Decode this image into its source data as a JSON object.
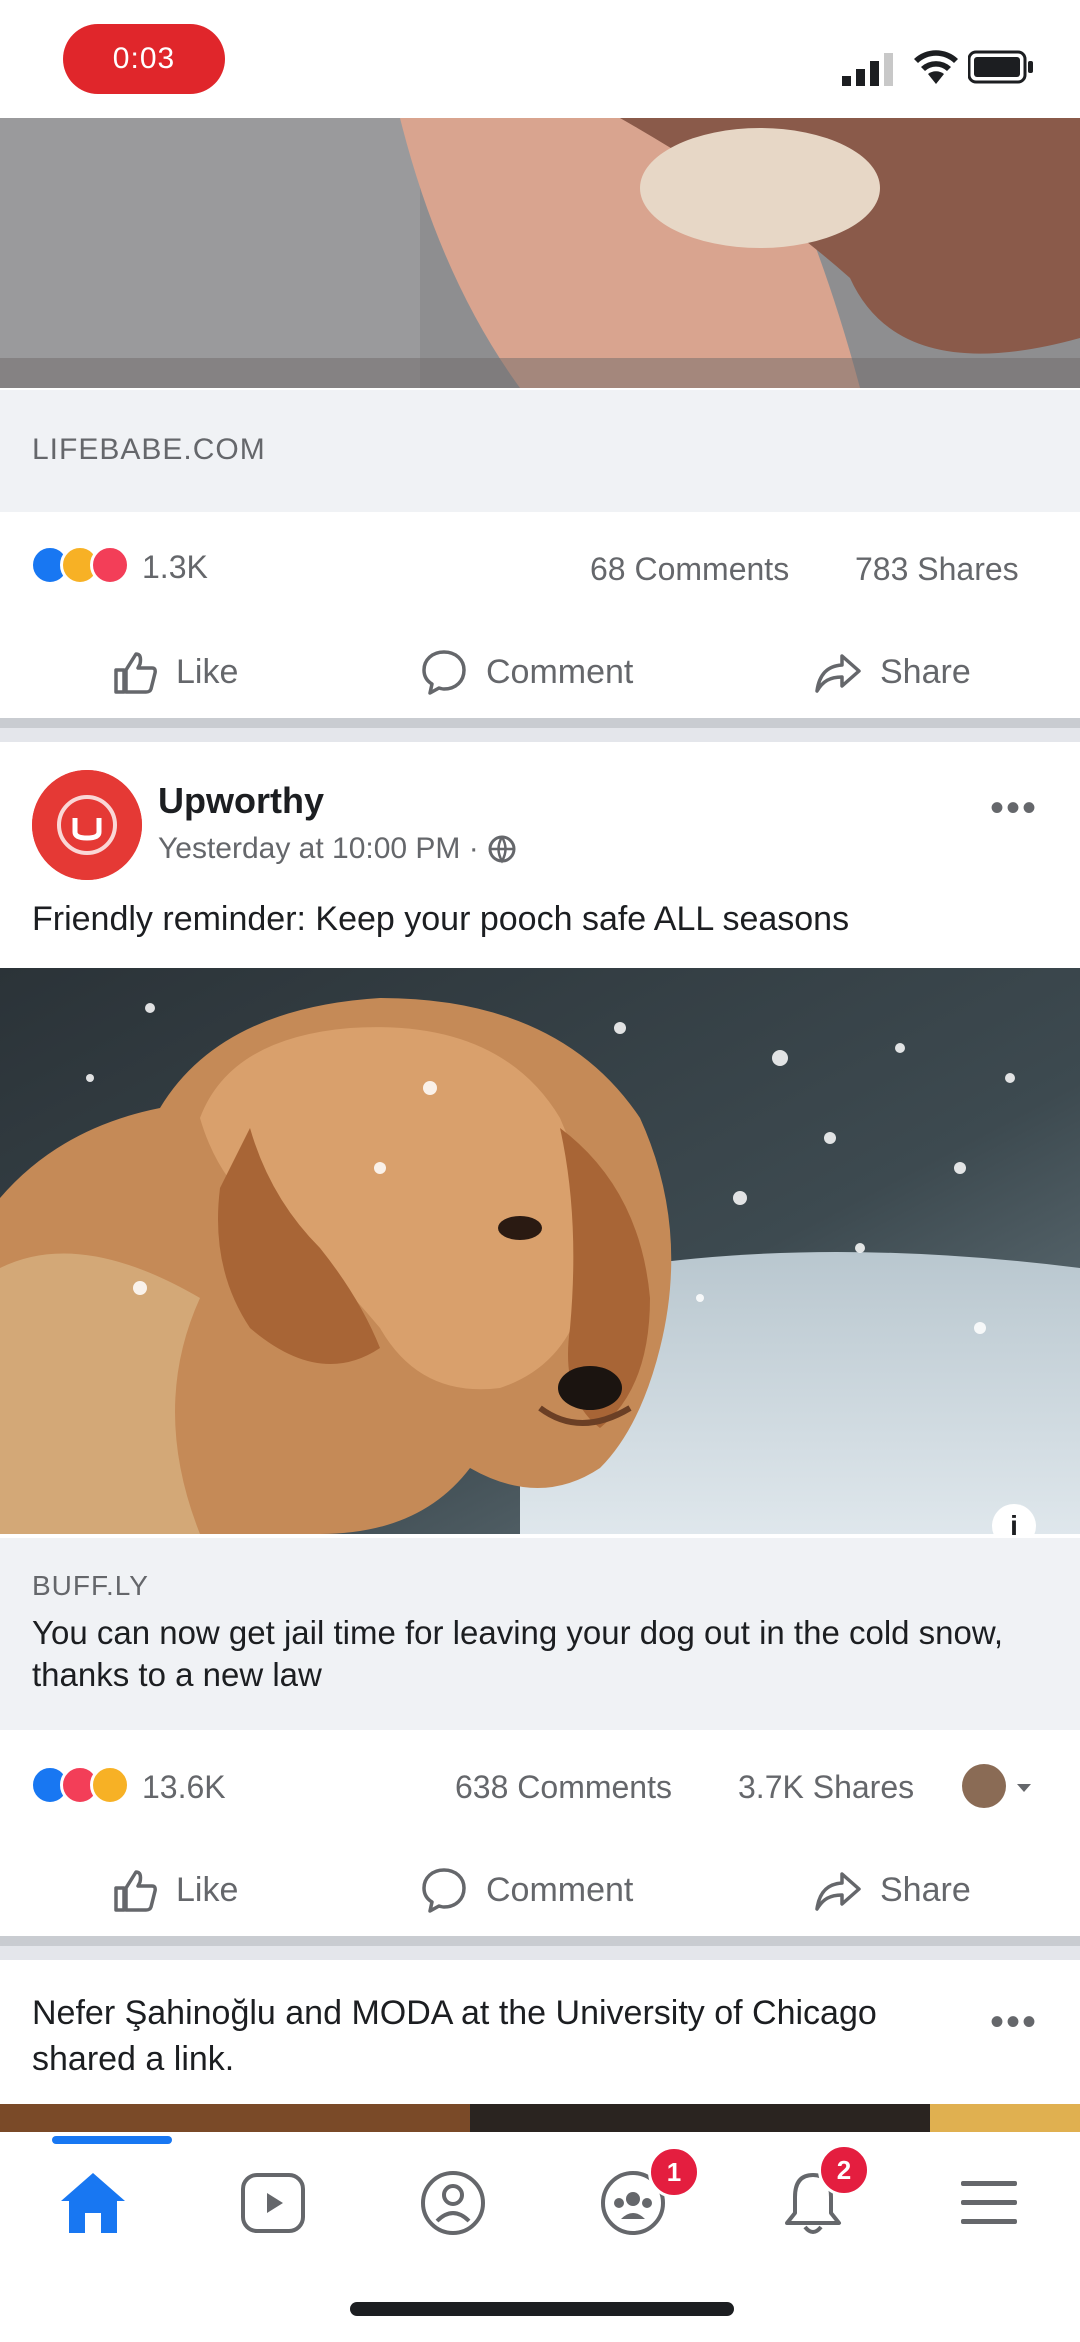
{
  "status_bar": {
    "recording_label": "0:03"
  },
  "post1": {
    "domain": "LIFEBABE.COM",
    "reaction_count": "1.3K",
    "comments": "68 Comments",
    "shares": "783 Shares"
  },
  "actions": {
    "like": "Like",
    "comment": "Comment",
    "share": "Share"
  },
  "post2": {
    "page_name": "Upworthy",
    "time": "Yesterday at 10:00 PM ·",
    "text": "Friendly reminder: Keep your pooch safe ALL seasons",
    "info_badge": "i",
    "domain": "BUFF.LY",
    "headline": "You can now get jail time for leaving your dog out in the cold snow, thanks to a new law",
    "reaction_count": "13.6K",
    "comments": "638 Comments",
    "shares": "3.7K Shares"
  },
  "post3": {
    "header_text": "Nefer Şahinoğlu and MODA at the University of Chicago shared a link."
  },
  "bottom_nav": {
    "groups_badge": "1",
    "notifications_badge": "2"
  },
  "colors": {
    "accent": "#1877f2",
    "badge": "#e41e3f",
    "recording": "#e0262b",
    "link_box": "#f0f2f5"
  }
}
